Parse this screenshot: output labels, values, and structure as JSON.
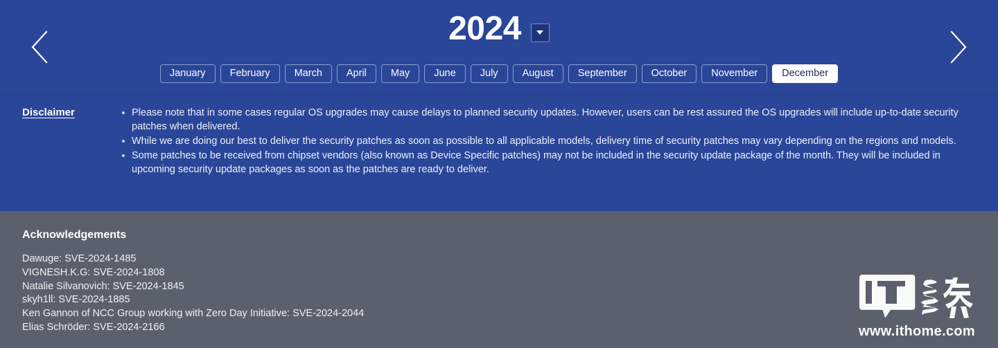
{
  "header": {
    "year": "2024",
    "prev_arrow_icon": "chevron-left-icon",
    "next_arrow_icon": "chevron-right-icon",
    "dropdown_icon": "caret-down-icon",
    "months": [
      {
        "label": "January",
        "active": false
      },
      {
        "label": "February",
        "active": false
      },
      {
        "label": "March",
        "active": false
      },
      {
        "label": "April",
        "active": false
      },
      {
        "label": "May",
        "active": false
      },
      {
        "label": "June",
        "active": false
      },
      {
        "label": "July",
        "active": false
      },
      {
        "label": "August",
        "active": false
      },
      {
        "label": "September",
        "active": false
      },
      {
        "label": "October",
        "active": false
      },
      {
        "label": "November",
        "active": false
      },
      {
        "label": "December",
        "active": true
      }
    ]
  },
  "disclaimer": {
    "label": "Disclaimer",
    "items": [
      "Please note that in some cases regular OS upgrades may cause delays to planned security updates. However, users can be rest assured the OS upgrades will include up-to-date security patches when delivered.",
      "While we are doing our best to deliver the security patches as soon as possible to all applicable models, delivery time of security patches may vary depending on the regions and models.",
      "Some patches to be received from chipset vendors (also known as Device Specific patches) may not be included in the security update package of the month. They will be included in upcoming security update packages as soon as the patches are ready to deliver."
    ]
  },
  "acknowledgements": {
    "title": "Acknowledgements",
    "lines": [
      "Dawuge: SVE-2024-1485",
      "VIGNESH.K.G: SVE-2024-1808",
      "Natalie Silvanovich: SVE-2024-1845",
      "skyh1ll: SVE-2024-1885",
      "Ken Gannon of NCC Group working with Zero Day Initiative: SVE-2024-2044",
      "Elias Schröder: SVE-2024-2166"
    ]
  },
  "watermark": {
    "logo_text": "IT",
    "logo_cjk": "之家",
    "url": "www.ithome.com"
  },
  "colors": {
    "panel_blue": "#2a4699",
    "panel_gray": "#5b616c",
    "active_month_bg": "#ffffff",
    "active_month_text": "#1f2d5c",
    "dropdown_bg": "#1d3478"
  }
}
